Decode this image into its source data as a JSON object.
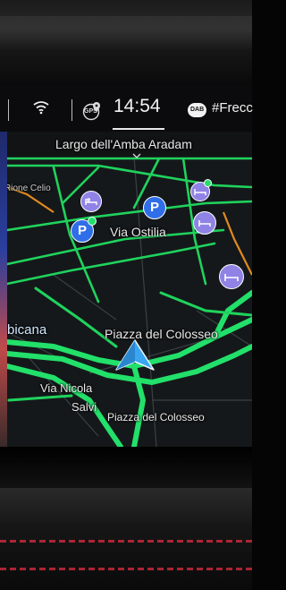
{
  "status_bar": {
    "gps_label": "GPS",
    "time": "14:54",
    "dab_label": "DAB",
    "station": "#Frecc"
  },
  "map": {
    "top_label": "Largo dell'Amba Aradam",
    "labels": {
      "rione_celio": "Rione Celio",
      "via_ostilia": "Via Ostilia",
      "bicana": "bicana",
      "piazza_del_colosseo_main": "Piazza del Colosseo",
      "via_nicola": "Via Nicola",
      "salvi": "Salvi",
      "piazza_del_colosseo_small": "Piazza del Colosseo"
    },
    "poi_colors": {
      "parking": "#2f6ee8",
      "hotel": "#8f83e6",
      "route": "#22e06a"
    }
  }
}
